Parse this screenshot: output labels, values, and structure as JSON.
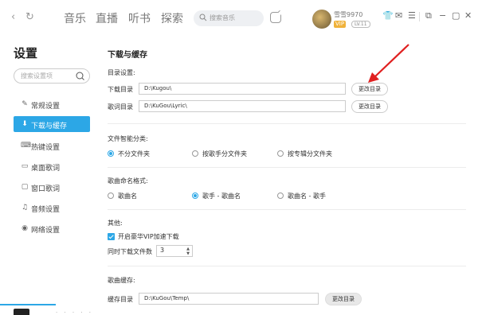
{
  "topbar": {
    "back": "‹",
    "refresh": "↻",
    "tabs": [
      "音乐",
      "直播",
      "听书",
      "探索"
    ],
    "search_placeholder": "搜索音乐",
    "username": "雪雪9970",
    "vip_badge": "VIP",
    "level_badge": "LV.11",
    "icons": [
      "shirt-icon",
      "mail-icon",
      "menu-icon",
      "mini-mode-icon",
      "minimize-icon",
      "maximize-icon",
      "close-icon"
    ]
  },
  "sidebar": {
    "title": "设置",
    "search_placeholder": "搜索设置项",
    "items": [
      {
        "label": "常规设置",
        "icon": "wrench-icon",
        "glyph": "✎"
      },
      {
        "label": "下载与缓存",
        "icon": "download-icon",
        "glyph": "⬇"
      },
      {
        "label": "热键设置",
        "icon": "keyboard-icon",
        "glyph": "⌨"
      },
      {
        "label": "桌面歌词",
        "icon": "desktop-lyric-icon",
        "glyph": "▭"
      },
      {
        "label": "窗口歌词",
        "icon": "window-lyric-icon",
        "glyph": "▢"
      },
      {
        "label": "音频设置",
        "icon": "audio-icon",
        "glyph": "♫"
      },
      {
        "label": "网络设置",
        "icon": "network-icon",
        "glyph": "◉"
      }
    ],
    "active_index": 1
  },
  "main": {
    "title": "下载与缓存",
    "dir_section": {
      "label": "目录设置:",
      "download_label": "下载目录",
      "download_path": "D:\\Kugou\\",
      "lyric_label": "歌词目录",
      "lyric_path": "D:\\KuGou\\Lyric\\",
      "change_button": "更改目录"
    },
    "classify_section": {
      "label": "文件智能分类:",
      "options": [
        "不分文件夹",
        "按歌手分文件夹",
        "按专辑分文件夹"
      ],
      "selected": 0
    },
    "naming_section": {
      "label": "歌曲命名格式:",
      "options": [
        "歌曲名",
        "歌手 - 歌曲名",
        "歌曲名 - 歌手"
      ],
      "selected": 1
    },
    "other_section": {
      "label": "其他:",
      "vip_accel_label": "开启豪华VIP加速下载",
      "vip_accel_checked": true,
      "concurrent_label": "同时下载文件数",
      "concurrent_value": "3"
    },
    "cache_section": {
      "label": "歌曲缓存:",
      "cache_label": "缓存目录",
      "cache_path": "D:\\KuGou\\Temp\\",
      "change_button": "更改目录"
    }
  },
  "colors": {
    "accent": "#2ca7e6",
    "annotation_arrow": "#e02020"
  }
}
